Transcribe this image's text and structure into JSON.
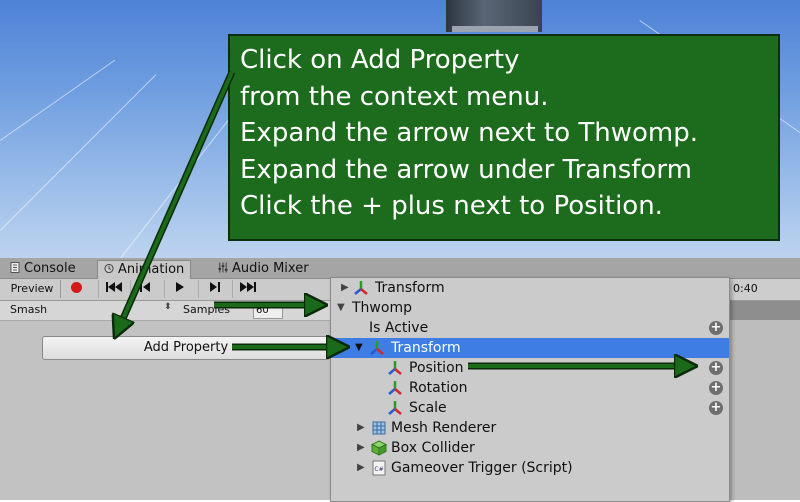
{
  "tabs": [
    {
      "label": "Console",
      "icon": "console-icon"
    },
    {
      "label": "Animation",
      "icon": "clock-icon"
    },
    {
      "label": "Audio Mixer",
      "icon": "sliders-icon"
    }
  ],
  "toolbar": {
    "preview_label": "Preview",
    "record_icon": "record-icon",
    "controls": [
      "first-key-icon",
      "prev-key-icon",
      "play-icon",
      "next-key-icon",
      "last-key-icon"
    ],
    "time_label": "0:40"
  },
  "clip": {
    "name": "Smash",
    "samples_label": "Samples",
    "samples_value": "60"
  },
  "add_property_label": "Add Property",
  "menu": {
    "items": [
      {
        "label": "Transform",
        "icon": "transform-icon"
      },
      {
        "label": "Thwomp"
      },
      {
        "label": "Is Active"
      },
      {
        "label": "Transform",
        "icon": "transform-icon",
        "selected": true
      },
      {
        "label": "Position",
        "icon": "transform-icon"
      },
      {
        "label": "Rotation",
        "icon": "transform-icon"
      },
      {
        "label": "Scale",
        "icon": "transform-icon"
      },
      {
        "label": "Mesh Renderer",
        "icon": "mesh-renderer-icon"
      },
      {
        "label": "Box Collider",
        "icon": "box-collider-icon"
      },
      {
        "label": "Gameover Trigger (Script)",
        "icon": "script-icon"
      }
    ]
  },
  "callout": {
    "lines": [
      "Click on Add Property",
      "from the context menu.",
      "Expand the arrow next to Thwomp.",
      "Expand the arrow under Transform",
      "Click the + plus next to Position."
    ]
  },
  "colors": {
    "callout_bg": "#1d6b1d",
    "selection": "#3e7ee4",
    "record": "#d21a1a",
    "arrow": "#1a6a1a"
  }
}
